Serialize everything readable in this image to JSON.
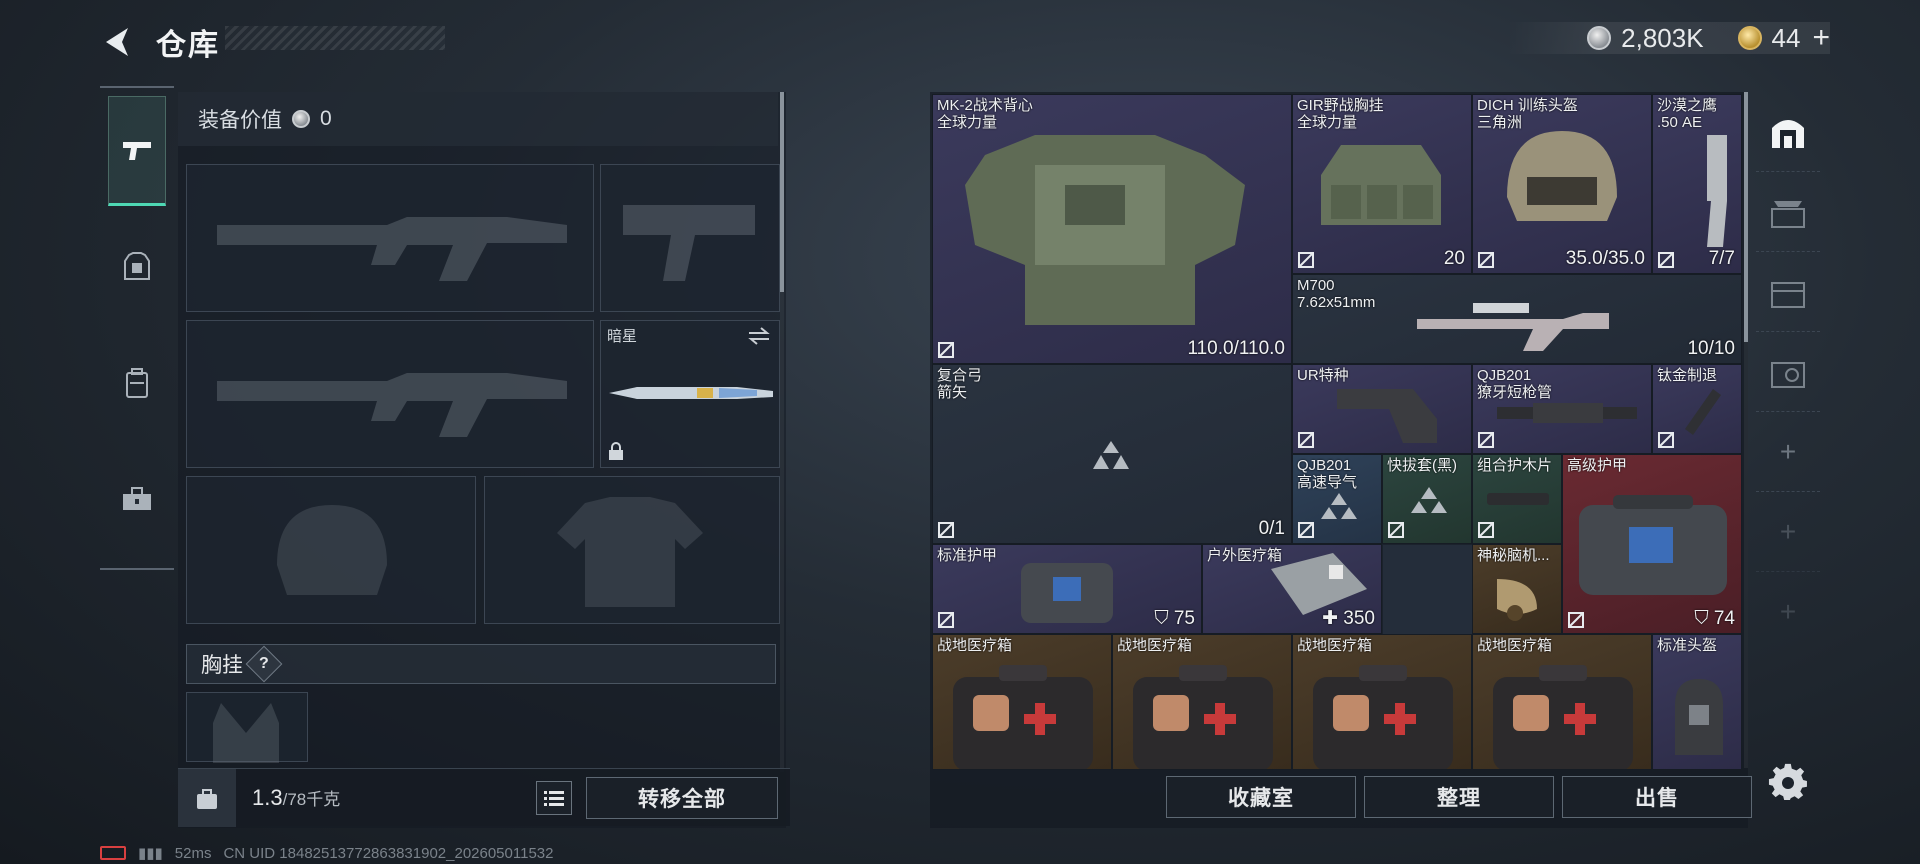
{
  "header": {
    "title": "仓库",
    "currency_silver": "2,803K",
    "currency_gold": "44",
    "gold_plus": "+"
  },
  "loadout": {
    "equip_value_label": "装备价值",
    "equip_value": "0",
    "melee_name": "暗星",
    "vest_label": "胸挂",
    "help": "?"
  },
  "bottom_left": {
    "weight": "1.3",
    "weight_max": "/78千克",
    "transfer_all": "转移全部"
  },
  "status": {
    "ping": "52ms",
    "uid": "CN UID 1848251377286383190​2_202605011532"
  },
  "storage": {
    "items": [
      {
        "name": "MK-2战术背心",
        "sub": "全球力量",
        "value": "110.0/110.0"
      },
      {
        "name": "GIR野战胸挂",
        "sub": "全球力量",
        "value": "20"
      },
      {
        "name": "DICH 训练头盔",
        "sub": "三角洲",
        "value": "35.0/35.0"
      },
      {
        "name": "沙漠之鹰",
        "sub": ".50 AE",
        "value": "7/7"
      },
      {
        "name": "M700",
        "sub": "7.62x51mm",
        "value": "10/10"
      },
      {
        "name": "复合弓",
        "sub": "箭矢",
        "value": "0/1"
      },
      {
        "name": "UR特种",
        "sub": "",
        "value": ""
      },
      {
        "name": "QJB201",
        "sub": "獠牙短枪管",
        "value": ""
      },
      {
        "name": "钛金制退",
        "sub": "",
        "value": ""
      },
      {
        "name": "QJB201",
        "sub": "高速导气",
        "value": ""
      },
      {
        "name": "快拔套(黑)",
        "sub": "",
        "value": ""
      },
      {
        "name": "组合护木片",
        "sub": "",
        "value": ""
      },
      {
        "name": "高级护甲",
        "sub": "",
        "value": "74"
      },
      {
        "name": "标准护甲",
        "sub": "",
        "value": "75"
      },
      {
        "name": "户外医疗箱",
        "sub": "",
        "value": "350"
      },
      {
        "name": "神秘脑机...",
        "sub": "",
        "value": ""
      },
      {
        "name": "战地医疗箱",
        "sub": "",
        "value": ""
      },
      {
        "name": "战地医疗箱",
        "sub": "",
        "value": ""
      },
      {
        "name": "战地医疗箱",
        "sub": "",
        "value": ""
      },
      {
        "name": "战地医疗箱",
        "sub": "",
        "value": ""
      },
      {
        "name": "标准头盔",
        "sub": "",
        "value": ""
      }
    ],
    "buttons": {
      "collection": "收藏室",
      "sort": "整理",
      "sell": "出售"
    }
  },
  "colors": {
    "accent": "#4ed8b4",
    "rare_purple": "#3b3a5c",
    "rare_red": "#6a2a32",
    "rare_gold": "#4c3d2a"
  },
  "icons": [
    "back-arrow-icon",
    "pistol-icon",
    "armor-icon",
    "backpack-icon",
    "toolbox-icon",
    "weight-icon",
    "list-icon",
    "settings-icon",
    "lock-icon",
    "swap-icon"
  ]
}
